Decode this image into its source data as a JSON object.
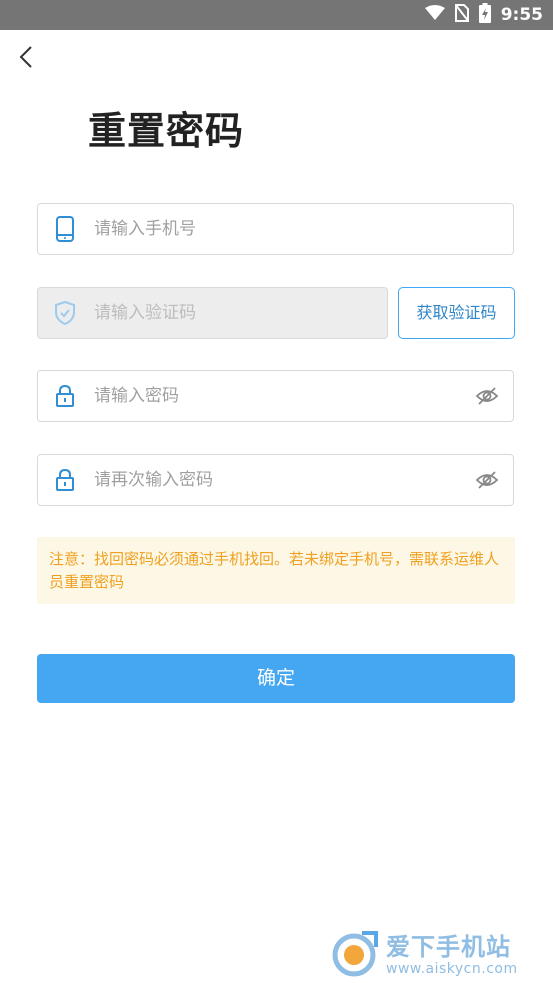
{
  "status_bar": {
    "time": "9:55",
    "icons": [
      "wifi-icon",
      "no-sim-icon",
      "battery-charging-icon"
    ]
  },
  "header": {
    "back_icon": "chevron-left-icon",
    "title": "重置密码"
  },
  "form": {
    "phone": {
      "placeholder": "请输入手机号",
      "icon": "phone-icon"
    },
    "code": {
      "placeholder": "请输入验证码",
      "icon": "shield-check-icon",
      "disabled": true
    },
    "get_code_button": "获取验证码",
    "password": {
      "placeholder": "请输入密码",
      "icon": "lock-icon",
      "toggle_icon": "eye-off-icon"
    },
    "confirm_password": {
      "placeholder": "请再次输入密码",
      "icon": "lock-icon",
      "toggle_icon": "eye-off-icon"
    }
  },
  "notice": {
    "text": "注意：找回密码必须通过手机找回。若未绑定手机号，需联系运维人员重置密码"
  },
  "confirm_button": "确定",
  "watermark": {
    "name": "爱下手机站",
    "url": "www.aiskycn.com"
  },
  "colors": {
    "accent": "#45a6f2",
    "icon_blue": "#2e8fd6",
    "notice_bg": "#fdf7e6",
    "notice_text": "#f0a020",
    "status_bar": "#757575"
  }
}
